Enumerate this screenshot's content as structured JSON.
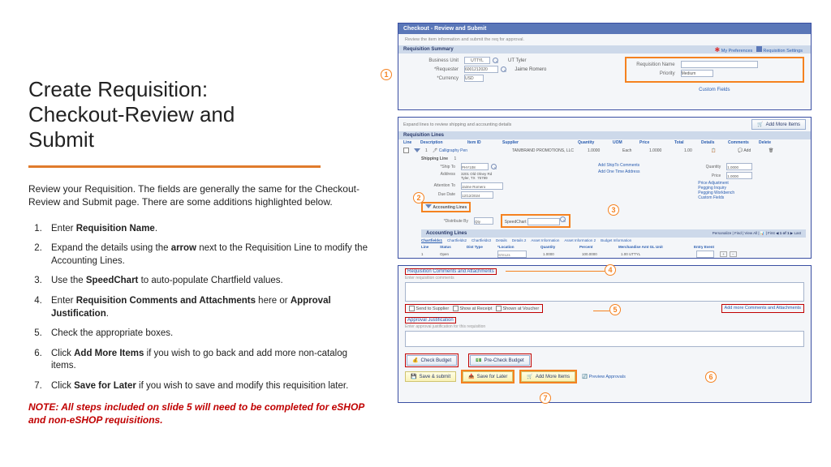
{
  "title_l1": "Create Requisition:",
  "title_l2": "Checkout-Review and",
  "title_l3": "Submit",
  "intro": "Review your Requisition. The fields are generally the same for the Checkout-Review and Submit page. There are some additions highlighted below.",
  "steps": {
    "s1a": "Enter ",
    "s1b": "Requisition Name",
    "s1c": ".",
    "s2a": "Expand the details using the ",
    "s2b": "arrow",
    "s2c": " next to the Requisition Line to modify the Accounting Lines.",
    "s3a": "Use the ",
    "s3b": "SpeedChart",
    "s3c": " to auto-populate Chartfield values.",
    "s4a": "Enter ",
    "s4b": "Requisition Comments and Attachments",
    "s4c": " here or ",
    "s4d": "Approval Justification",
    "s4e": ".",
    "s5": "Check the appropriate boxes.",
    "s6a": "Click ",
    "s6b": "Add More Items",
    "s6c": " if you wish to go back and add more non-catalog items.",
    "s7a": "Click ",
    "s7b": "Save for Later",
    "s7c": " if you wish to save and modify this requisition later."
  },
  "note": "NOTE: All steps included on slide 5 will need to be completed for eSHOP and non-eSHOP requisitions.",
  "p1": {
    "header": "Checkout - Review and Submit",
    "sub": "Review the item information and submit the req for approval.",
    "pref": "My Preferences",
    "settings": "Requisition Settings",
    "summary": "Requisition Summary",
    "bu": "Business Unit",
    "bu_v": "UTTYL",
    "bu_txt": "UT Tyler",
    "req": "*Requester",
    "req_v": "6001212020",
    "req_n": "Jaime Romero",
    "cur": "*Currency",
    "cur_v": "USD",
    "name": "Requisition Name",
    "pri": "Priority",
    "pri_v": "Medium",
    "custom": "Custom Fields"
  },
  "p2": {
    "hint": "Expand lines to review shipping and accounting details",
    "add_more": "Add More Items",
    "bar": "Requisition Lines",
    "cols": {
      "line": "Line",
      "desc": "Description",
      "item": "Item ID",
      "supp": "Supplier",
      "qty": "Quantity",
      "uom": "UOM",
      "price": "Price",
      "total": "Total",
      "det": "Details",
      "com": "Comments",
      "del": "Delete"
    },
    "r": {
      "line": "1",
      "desc": "Calligraphy Pen",
      "supp": "TAN/BRAND PROMOTIONS, LLC",
      "qty": "1.0000",
      "uom": "Each",
      "price": "1.0000",
      "total": "1.00",
      "add": "Add"
    },
    "ship": "Shipping Line",
    "ship_v": "1",
    "shipto": "*Ship To",
    "shipto_v": "PHY108",
    "addshipto": "Add ShipTo Comments",
    "qty2": "Quantity",
    "qty2_v": "1.0000",
    "addr": "Address",
    "addr_v": "3201 Old Olney Rd\nTyler, TX  75799",
    "addone": "Add One Time Address",
    "price2": "Price",
    "price2_v": "1.0000",
    "att": "Attention To",
    "att_v": "Jaime Romero",
    "due": "Due Date",
    "due_v": "12/12/2024",
    "padj": "Price Adjustment",
    "pinq": "Pegging Inquiry",
    "pwb": "Pegging Workbench",
    "cf": "Custom Fields",
    "accl": "Accounting Lines",
    "dist": "*Distribute By",
    "dist_v": "Qty",
    "sc": "SpeedChart",
    "accbar": "Accounting Lines",
    "pers": "Personalize | Find | View All |",
    "first": "First",
    "of": "1 of 1",
    "last": "Last",
    "tabs": {
      "cf": "Chartfields1",
      "cf2": "Chartfields2",
      "cf3": "Chartfields3",
      "d": "Details",
      "d2": "Details 2",
      "ai": "Asset Information",
      "ai2": "Asset Information 2",
      "bi": "Budget Information"
    },
    "acc_cols": {
      "line": "Line",
      "stat": "Status",
      "dt": "Dist Type",
      "loc": "*Location",
      "qty": "Quantity",
      "pct": "Percent",
      "ma": "Merchandise Amt  GL Unit",
      "ee": "Entry Event"
    },
    "acc_row": {
      "line": "1",
      "stat": "Open",
      "loc": "STE123",
      "qty": "1.0000",
      "pct": "100.0000",
      "ma": "1.00  UTTYL"
    }
  },
  "p3": {
    "t": "Requisition Comments and Attachments",
    "enter": "Enter requisition comments",
    "c1": "Send to Supplier",
    "c2": "Show at Receipt",
    "c3": "Shown at Voucher",
    "more": "Add more Comments and Attachments",
    "aj": "Approval Justification",
    "aj_sub": "Enter approval justification for this requisition",
    "cb": "Check Budget",
    "pcb": "Pre-Check Budget",
    "save": "Save & submit",
    "sfl": "Save for Later",
    "ami": "Add More Items",
    "pa": "Preview Approvals"
  }
}
